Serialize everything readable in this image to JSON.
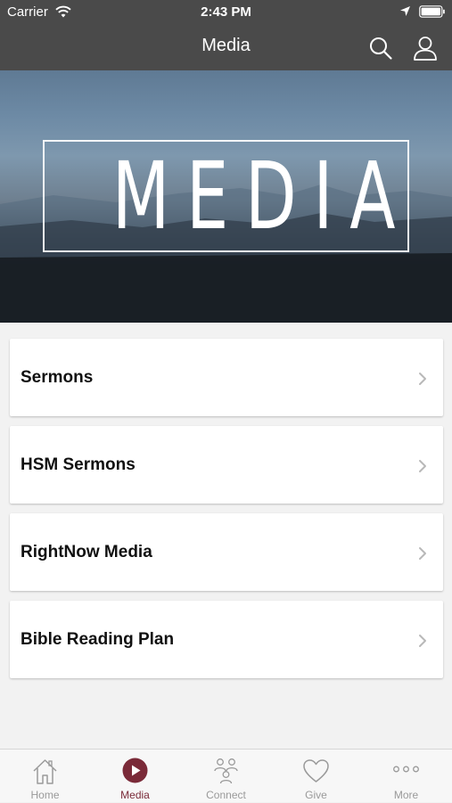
{
  "status_bar": {
    "carrier": "Carrier",
    "time": "2:43 PM",
    "icons": [
      "wifi-icon",
      "location-icon",
      "battery-icon"
    ]
  },
  "nav": {
    "title": "Media",
    "actions": [
      "search-icon",
      "user-icon"
    ]
  },
  "hero": {
    "text": "MEDIA"
  },
  "menu": {
    "items": [
      {
        "label": "Sermons"
      },
      {
        "label": "HSM Sermons"
      },
      {
        "label": "RightNow Media"
      },
      {
        "label": "Bible Reading Plan"
      }
    ]
  },
  "tabs": {
    "items": [
      {
        "label": "Home",
        "icon": "home-icon"
      },
      {
        "label": "Media",
        "icon": "play-icon"
      },
      {
        "label": "Connect",
        "icon": "people-icon"
      },
      {
        "label": "Give",
        "icon": "heart-icon"
      },
      {
        "label": "More",
        "icon": "more-icon"
      }
    ],
    "active_index": 1
  },
  "colors": {
    "header_bg": "#4a4a4a",
    "accent": "#7a2a38",
    "tab_inactive": "#9a9a9a",
    "page_bg": "#f2f2f2"
  }
}
